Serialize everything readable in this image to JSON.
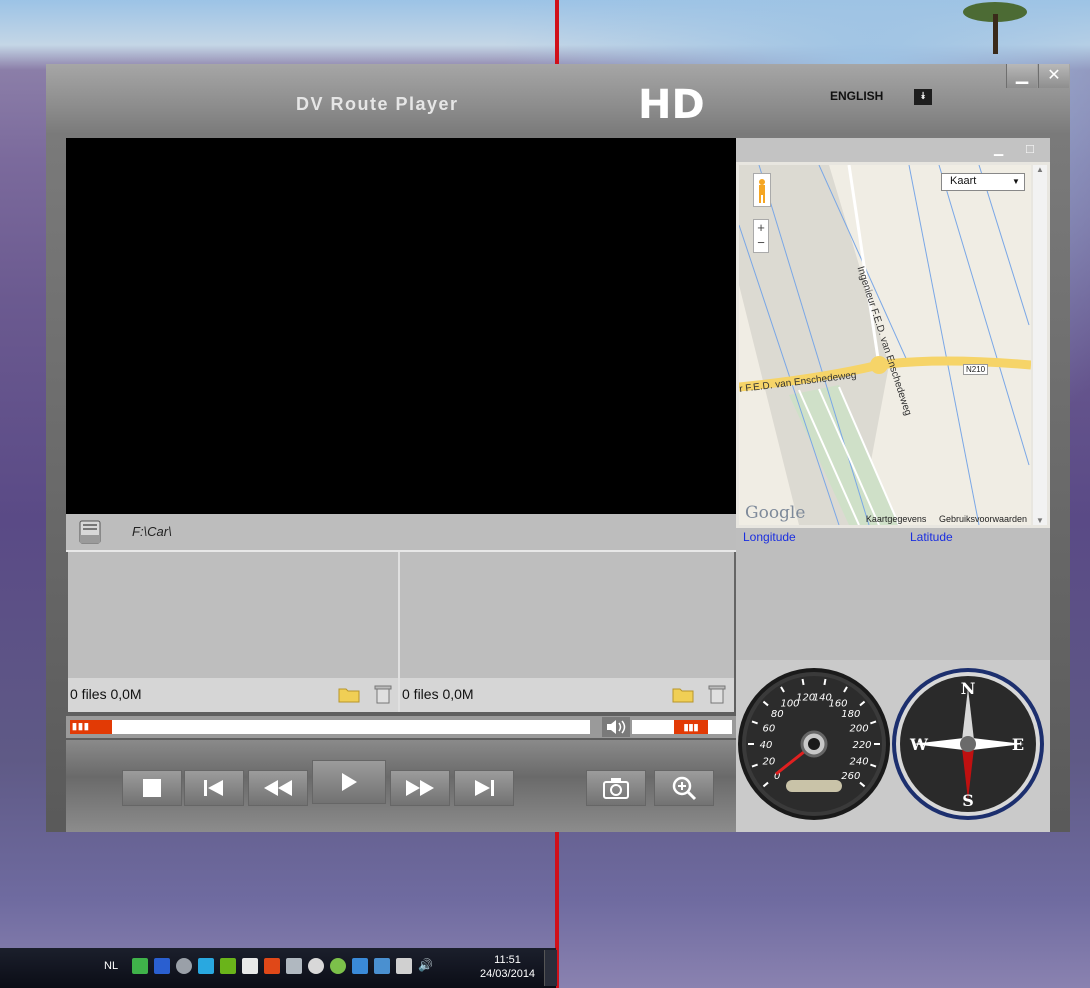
{
  "app": {
    "title": "DV Route Player",
    "logo_text": "HD",
    "language": "ENGLISH",
    "window_buttons": [
      "minimize",
      "close"
    ]
  },
  "file_browser": {
    "path": "F:\\Car\\",
    "left_list": {
      "files_info": "0 files 0,0M"
    },
    "right_list": {
      "files_info": "0 files 0,0M"
    }
  },
  "playback": {
    "progress": 0.08,
    "volume": 0.34
  },
  "controls": [
    "stop",
    "previous",
    "rewind",
    "play",
    "fast-forward",
    "next",
    "snapshot",
    "zoom"
  ],
  "map": {
    "map_type": "Kaart",
    "road_label_1": "Ingenieur F.E.D. van Enschedeweg",
    "road_label_2": "r F.E.D. van Enschedeweg",
    "road_badge": "N210",
    "google": "Google",
    "attribution_1": "Kaartgegevens",
    "attribution_2": "Gebruiksvoorwaarden",
    "zoom_in": "+",
    "zoom_out": "−"
  },
  "coords": {
    "longitude_label": "Longitude",
    "latitude_label": "Latitude"
  },
  "speedometer": {
    "ticks": [
      "0",
      "20",
      "40",
      "60",
      "80",
      "100",
      "120",
      "140",
      "160",
      "180",
      "200",
      "220",
      "240",
      "260"
    ]
  },
  "compass": {
    "n": "N",
    "e": "E",
    "s": "S",
    "w": "W"
  },
  "taskbar": {
    "language": "NL",
    "time": "11:51",
    "date": "24/03/2014"
  },
  "colors": {
    "accent": "#e23a05",
    "coord_label": "#1a2ee0",
    "compass_ring": "#1c2f6e"
  }
}
